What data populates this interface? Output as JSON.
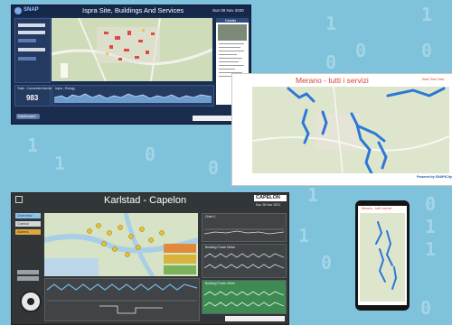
{
  "background": {
    "color": "#7fc2dc",
    "pattern_digits": [
      "1",
      "0",
      "0",
      "1",
      "0",
      "1",
      "1",
      "0",
      "1",
      "0",
      "0",
      "1",
      "1",
      "0",
      "0",
      "1"
    ]
  },
  "screen1": {
    "title": "Ispra Site, Buildings And Services",
    "brand": "SNAP",
    "date": "Sun 09 Nov 2020",
    "info_panel_title": "Details",
    "counter_label": "Total - Connected devices",
    "counter_value": "983",
    "chart_label": "Ispra - Energy",
    "button_label": "Dashboard",
    "accent": "#1b2d4e"
  },
  "screen2": {
    "title": "Merano - tutti i servizi",
    "subtitle": "Real Time View",
    "footer_brand": "Powered by SNAP4City",
    "title_color": "#d9403a",
    "route_color": "#2d78d6"
  },
  "screen3": {
    "title": "Karlstad - Capelon",
    "logo": "CAPELON",
    "date": "Sun 28 Nov 2021",
    "left_buttons": [
      "Overview",
      "Control",
      "Alarms"
    ],
    "chart_titles": [
      "Chart 1",
      "Building Power Meter",
      "Building Power Meter"
    ],
    "accent_green": "#3e8a53"
  },
  "screen4": {
    "title": "Merano - tutti i servizi",
    "device": "phone"
  }
}
